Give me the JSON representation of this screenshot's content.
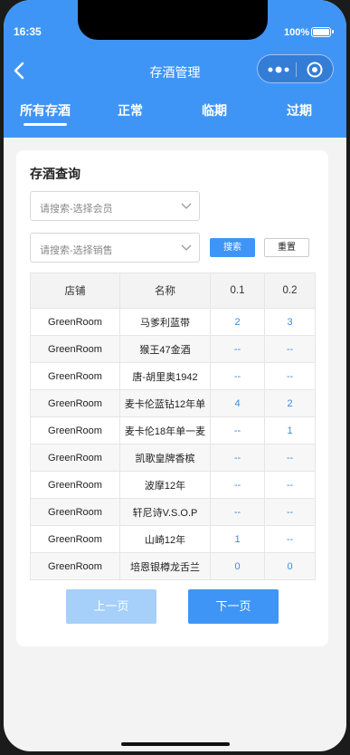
{
  "status_bar": {
    "time": "16:35",
    "battery": "100%"
  },
  "nav": {
    "title": "存酒管理"
  },
  "tabs": [
    {
      "label": "所有存酒",
      "active": true
    },
    {
      "label": "正常",
      "active": false
    },
    {
      "label": "临期",
      "active": false
    },
    {
      "label": "过期",
      "active": false
    }
  ],
  "query": {
    "title": "存酒查询",
    "member_placeholder": "请搜索-选择会员",
    "sales_placeholder": "请搜索-选择销售",
    "search_label": "搜索",
    "reset_label": "重置"
  },
  "table": {
    "headers": [
      "店铺",
      "名称",
      "0.1",
      "0.2"
    ],
    "rows": [
      [
        "GreenRoom",
        "马爹利蓝带",
        "2",
        "3"
      ],
      [
        "GreenRoom",
        "猴王47金酒",
        "--",
        "--"
      ],
      [
        "GreenRoom",
        "唐-胡里奥1942",
        "--",
        "--"
      ],
      [
        "GreenRoom",
        "麦卡伦蓝钻12年单",
        "4",
        "2"
      ],
      [
        "GreenRoom",
        "麦卡伦18年单一麦",
        "--",
        "1"
      ],
      [
        "GreenRoom",
        "凯歌皇牌香槟",
        "--",
        "--"
      ],
      [
        "GreenRoom",
        "波摩12年",
        "--",
        "--"
      ],
      [
        "GreenRoom",
        "轩尼诗V.S.O.P",
        "--",
        "--"
      ],
      [
        "GreenRoom",
        "山崎12年",
        "1",
        "--"
      ],
      [
        "GreenRoom",
        "培恩银樽龙舌兰",
        "0",
        "0"
      ]
    ]
  },
  "pager": {
    "prev_label": "上一页",
    "next_label": "下一页"
  },
  "colors": {
    "primary": "#3f95f5",
    "primary_disabled": "#a6cffa",
    "number": "#3f8ae0"
  }
}
